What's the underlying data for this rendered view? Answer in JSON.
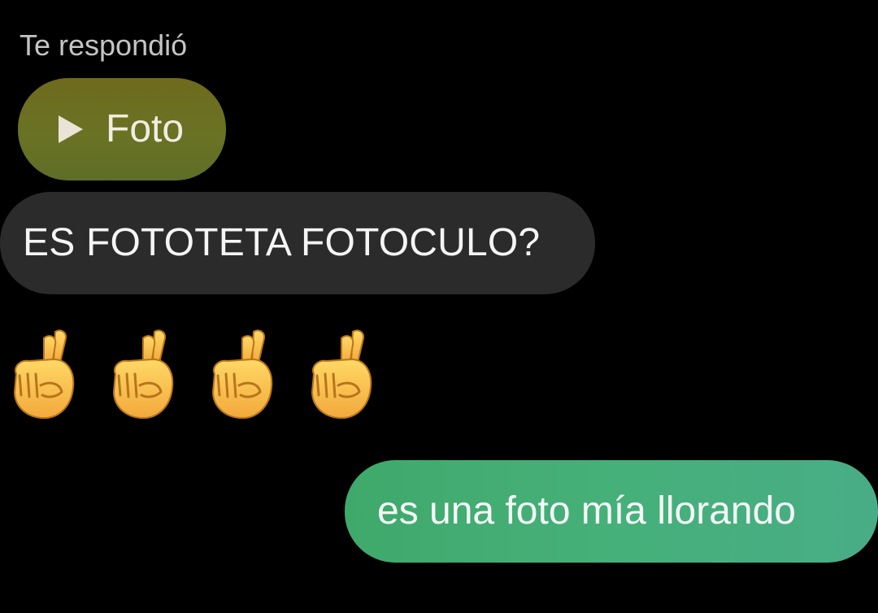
{
  "reply_header": {
    "label": "Te respondió"
  },
  "replied_attachment": {
    "label": "Foto",
    "icon": "play-icon",
    "bubble_color": "#6a7224"
  },
  "received_message": {
    "text": "ES FOTOTETA FOTOCULO?",
    "bubble_color": "#2b2b2b"
  },
  "emoji_message": {
    "emojis": [
      "crossed-fingers-emoji",
      "crossed-fingers-emoji",
      "crossed-fingers-emoji",
      "crossed-fingers-emoji"
    ]
  },
  "sent_message": {
    "text": "es una foto mía llorando",
    "bubble_color": "#46b07a"
  }
}
